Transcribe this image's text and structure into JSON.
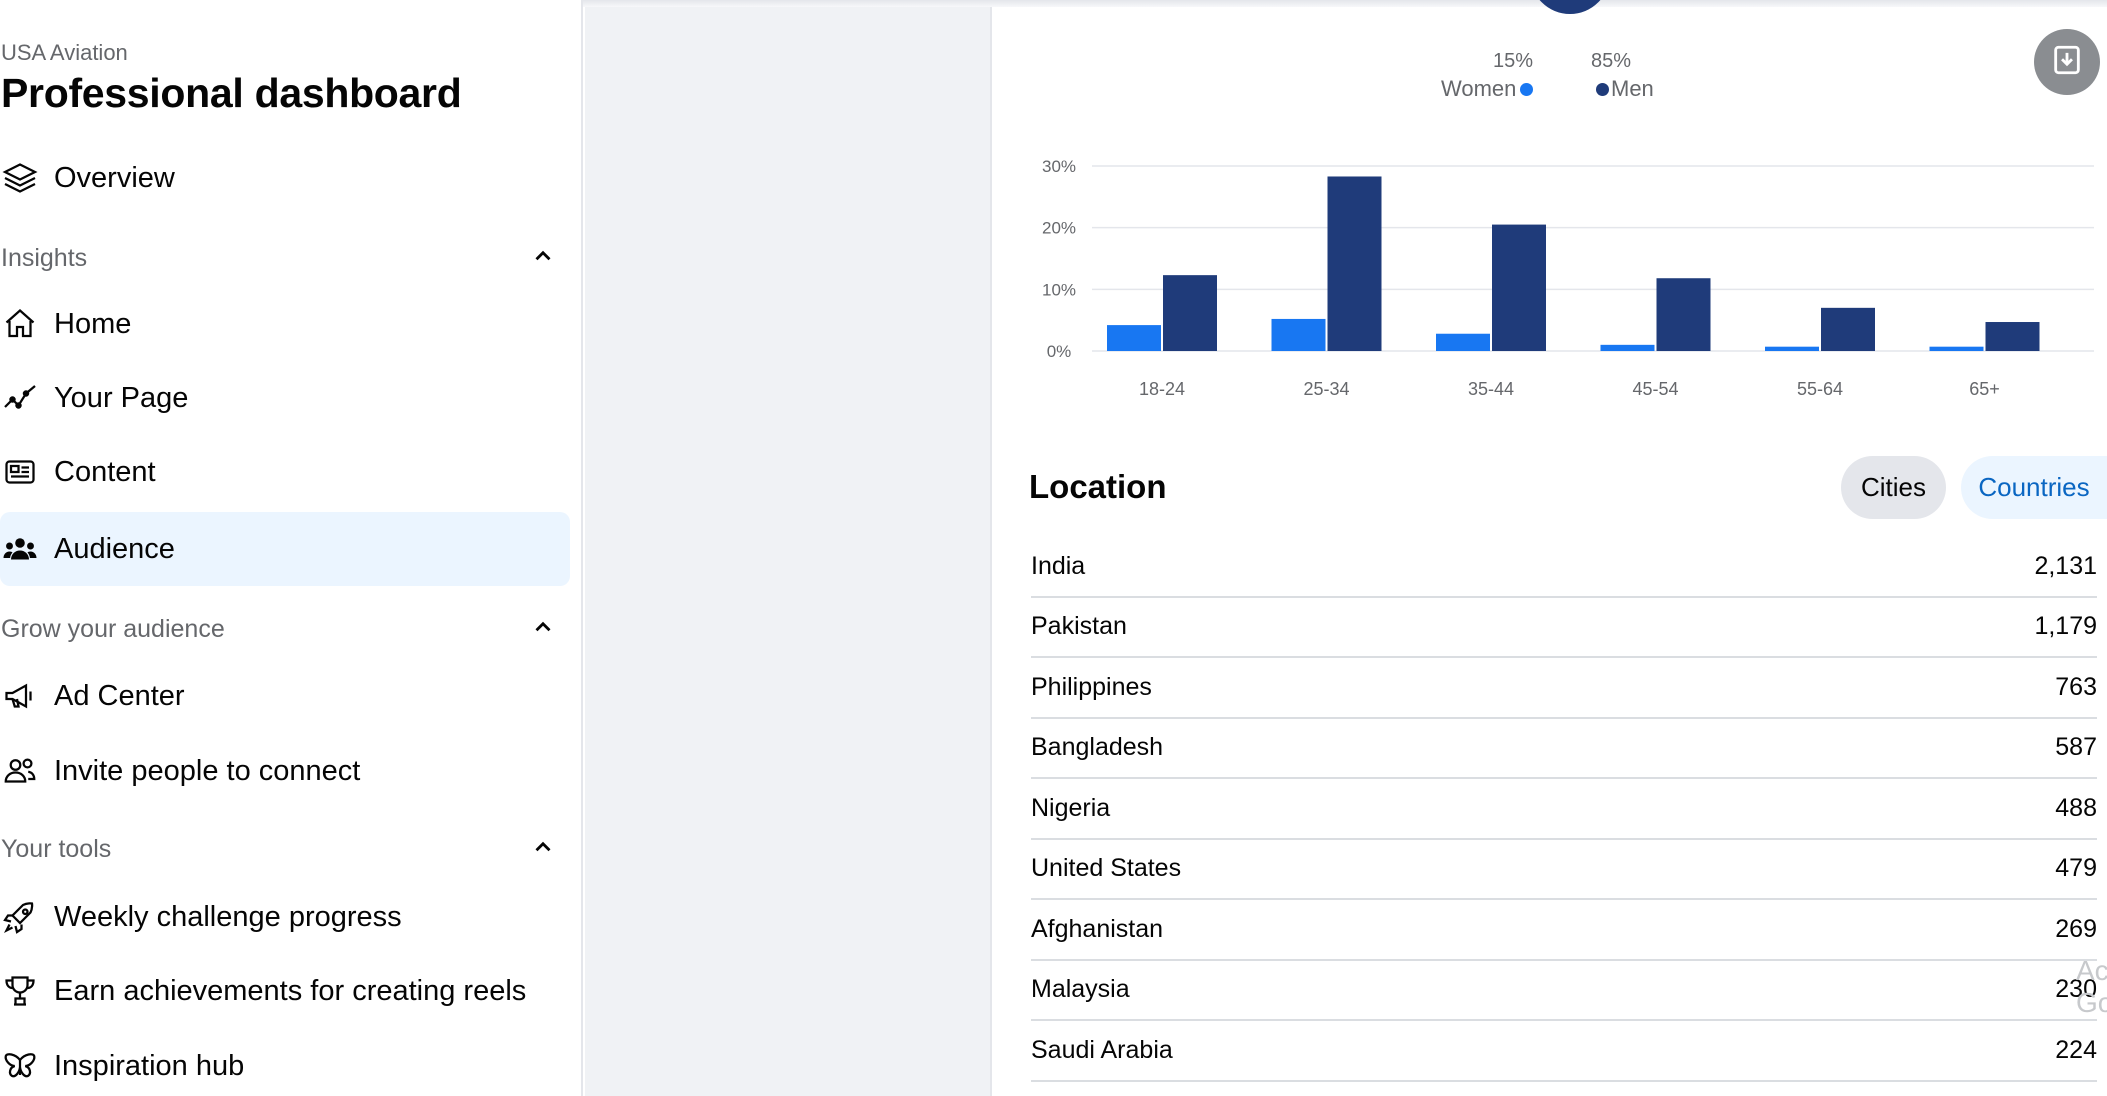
{
  "sidebar": {
    "page_name": "USA Aviation",
    "title": "Professional dashboard",
    "overview": "Overview",
    "sections": {
      "insights": "Insights",
      "grow": "Grow your audience",
      "tools": "Your tools"
    },
    "items": {
      "home": "Home",
      "your_page": "Your Page",
      "content": "Content",
      "audience": "Audience",
      "ad_center": "Ad Center",
      "invite": "Invite people to connect",
      "weekly": "Weekly challenge progress",
      "achievements": "Earn achievements for creating reels",
      "inspiration": "Inspiration hub"
    }
  },
  "gender": {
    "women_pct": "15%",
    "men_pct": "85%",
    "women_label": "Women",
    "men_label": "Men",
    "women_color": "#1877f2",
    "men_color": "#1f3b7a"
  },
  "chart_data": {
    "type": "bar",
    "categories": [
      "18-24",
      "25-34",
      "35-44",
      "45-54",
      "55-64",
      "65+"
    ],
    "series": [
      {
        "name": "Women",
        "color": "#1877f2",
        "values": [
          4.2,
          5.2,
          2.8,
          1.0,
          0.7,
          0.7
        ]
      },
      {
        "name": "Men",
        "color": "#1f3b7a",
        "values": [
          12.3,
          28.3,
          20.5,
          11.8,
          7.0,
          4.7
        ]
      }
    ],
    "yticks": [
      "0%",
      "10%",
      "20%",
      "30%"
    ],
    "ylim": [
      0,
      30
    ],
    "grid": true
  },
  "location": {
    "title": "Location",
    "cities_label": "Cities",
    "countries_label": "Countries",
    "rows": [
      {
        "country": "India",
        "value": "2,131"
      },
      {
        "country": "Pakistan",
        "value": "1,179"
      },
      {
        "country": "Philippines",
        "value": "763"
      },
      {
        "country": "Bangladesh",
        "value": "587"
      },
      {
        "country": "Nigeria",
        "value": "488"
      },
      {
        "country": "United States",
        "value": "479"
      },
      {
        "country": "Afghanistan",
        "value": "269"
      },
      {
        "country": "Malaysia",
        "value": "230"
      },
      {
        "country": "Saudi Arabia",
        "value": "224"
      }
    ]
  },
  "watermark": {
    "line1": "Ac",
    "line2": "Go"
  }
}
